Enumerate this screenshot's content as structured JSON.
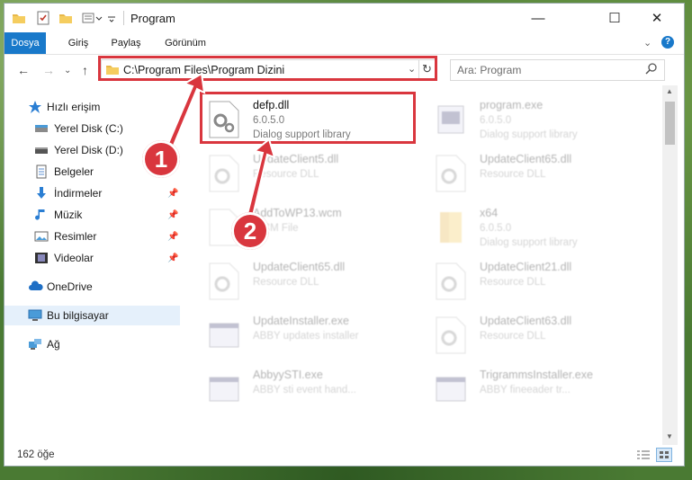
{
  "window": {
    "title": "Program",
    "buttons": {
      "minimize": "—",
      "maximize": "☐",
      "close": "✕"
    }
  },
  "ribbon": {
    "tabs": [
      {
        "label": "Dosya",
        "active": true
      },
      {
        "label": "Giriş"
      },
      {
        "label": "Paylaş"
      },
      {
        "label": "Görünüm"
      }
    ]
  },
  "address": {
    "path": "C:\\Program Files\\Program Dizini",
    "search_placeholder": "Ara: Program"
  },
  "nav_pane": {
    "items": [
      {
        "label": "Hızlı erişim",
        "icon": "star-icon"
      },
      {
        "label": "Yerel Disk (C:)",
        "icon": "drive-icon"
      },
      {
        "label": "Yerel Disk (D:)",
        "icon": "drive-icon"
      },
      {
        "label": "Belgeler",
        "icon": "document-icon"
      },
      {
        "label": "İndirmeler",
        "icon": "download-icon"
      },
      {
        "label": "Müzik",
        "icon": "music-icon"
      },
      {
        "label": "Resimler",
        "icon": "pictures-icon"
      },
      {
        "label": "Videolar",
        "icon": "video-icon"
      },
      {
        "label": "OneDrive",
        "icon": "cloud-icon"
      },
      {
        "label": "Bu bilgisayar",
        "icon": "computer-icon",
        "selected": true
      },
      {
        "label": "Ağ",
        "icon": "network-icon"
      }
    ]
  },
  "files": [
    {
      "name": "defp.dll",
      "line2": "6.0.5.0",
      "line3": "Dialog support library",
      "highlighted": true
    },
    {
      "name": "program.exe",
      "line2": "6.0.5.0",
      "line3": "Dialog support library"
    },
    {
      "name": "UpdateClient5.dll",
      "line2": "Resource DLL",
      "line3": ""
    },
    {
      "name": "UpdateClient65.dll",
      "line2": "Resource DLL",
      "line3": ""
    },
    {
      "name": "AddToWP13.wcm",
      "line2": "WCM File",
      "line3": ""
    },
    {
      "name": "x64",
      "line2": "6.0.5.0",
      "line3": "Dialog support library"
    },
    {
      "name": "UpdateClient65.dll",
      "line2": "Resource DLL",
      "line3": ""
    },
    {
      "name": "UpdateClient21.dll",
      "line2": "Resource DLL",
      "line3": ""
    },
    {
      "name": "UpdateInstaller.exe",
      "line2": "ABBY updates installer",
      "line3": ""
    },
    {
      "name": "UpdateClient63.dll",
      "line2": "Resource DLL",
      "line3": ""
    },
    {
      "name": "AbbyySTI.exe",
      "line2": "ABBY sti event hand...",
      "line3": ""
    },
    {
      "name": "TrigrammsInstaller.exe",
      "line2": "ABBY fineeader tr...",
      "line3": ""
    }
  ],
  "status": {
    "count": "162 öğe"
  },
  "annotations": {
    "badge1": "1",
    "badge2": "2"
  },
  "colors": {
    "accent": "#1979ca",
    "highlight": "#d9363e"
  }
}
